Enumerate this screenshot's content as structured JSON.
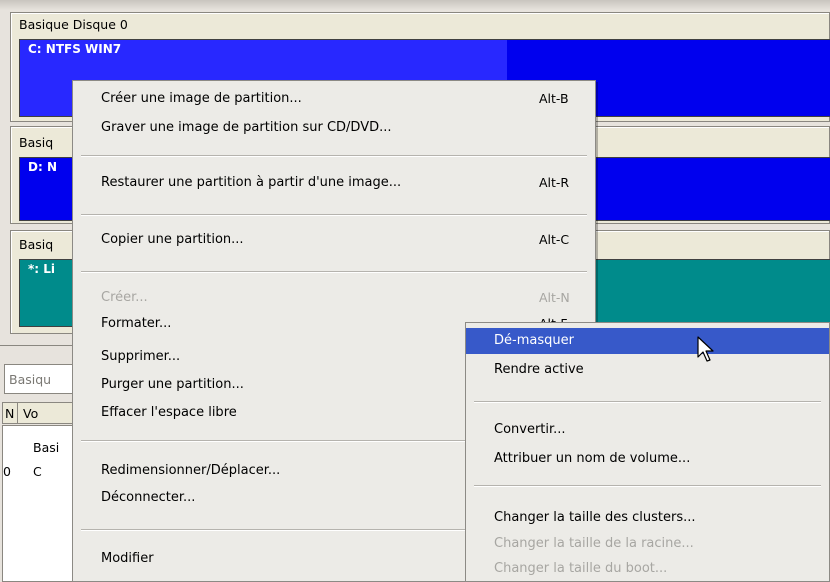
{
  "disks": [
    {
      "title": "Basique Disque 0",
      "partition": "C: NTFS  WIN7"
    },
    {
      "title": "Basiq",
      "partition": "D: N"
    },
    {
      "title": "Basiq",
      "partition": "*: Li"
    }
  ],
  "lower": {
    "combo": "Basiqu",
    "col_n": "N",
    "col_v": "Vo",
    "group": "Basi",
    "row_num": "0",
    "row_c": "C"
  },
  "context_menu": {
    "items": [
      {
        "label": "Créer une image de partition...",
        "accel": "Alt-B"
      },
      {
        "label": "Graver une image de partition sur CD/DVD...",
        "accel": ""
      },
      {
        "label": "Restaurer une partition à partir d'une image...",
        "accel": "Alt-R"
      },
      {
        "label": "Copier une partition...",
        "accel": "Alt-C"
      },
      {
        "label": "Créer...",
        "accel": "Alt-N"
      },
      {
        "label": "Formater...",
        "accel": "Alt-F"
      },
      {
        "label": "Supprimer...",
        "accel": ""
      },
      {
        "label": "Purger une partition...",
        "accel": ""
      },
      {
        "label": "Effacer l'espace libre",
        "accel": ""
      },
      {
        "label": "Redimensionner/Déplacer...",
        "accel": ""
      },
      {
        "label": "Déconnecter...",
        "accel": ""
      },
      {
        "label": "Modifier",
        "accel": ""
      }
    ]
  },
  "submenu": {
    "items": [
      {
        "label": "Dé-masquer"
      },
      {
        "label": "Rendre active"
      },
      {
        "label": "Convertir..."
      },
      {
        "label": "Attribuer un nom de volume..."
      },
      {
        "label": "Changer la taille des clusters..."
      },
      {
        "label": "Changer la taille de la racine..."
      },
      {
        "label": "Changer la taille du boot..."
      }
    ]
  },
  "colors": {
    "partition_blue": "#0000ee",
    "partition_teal": "#008b8b",
    "highlight": "#3759c9"
  }
}
